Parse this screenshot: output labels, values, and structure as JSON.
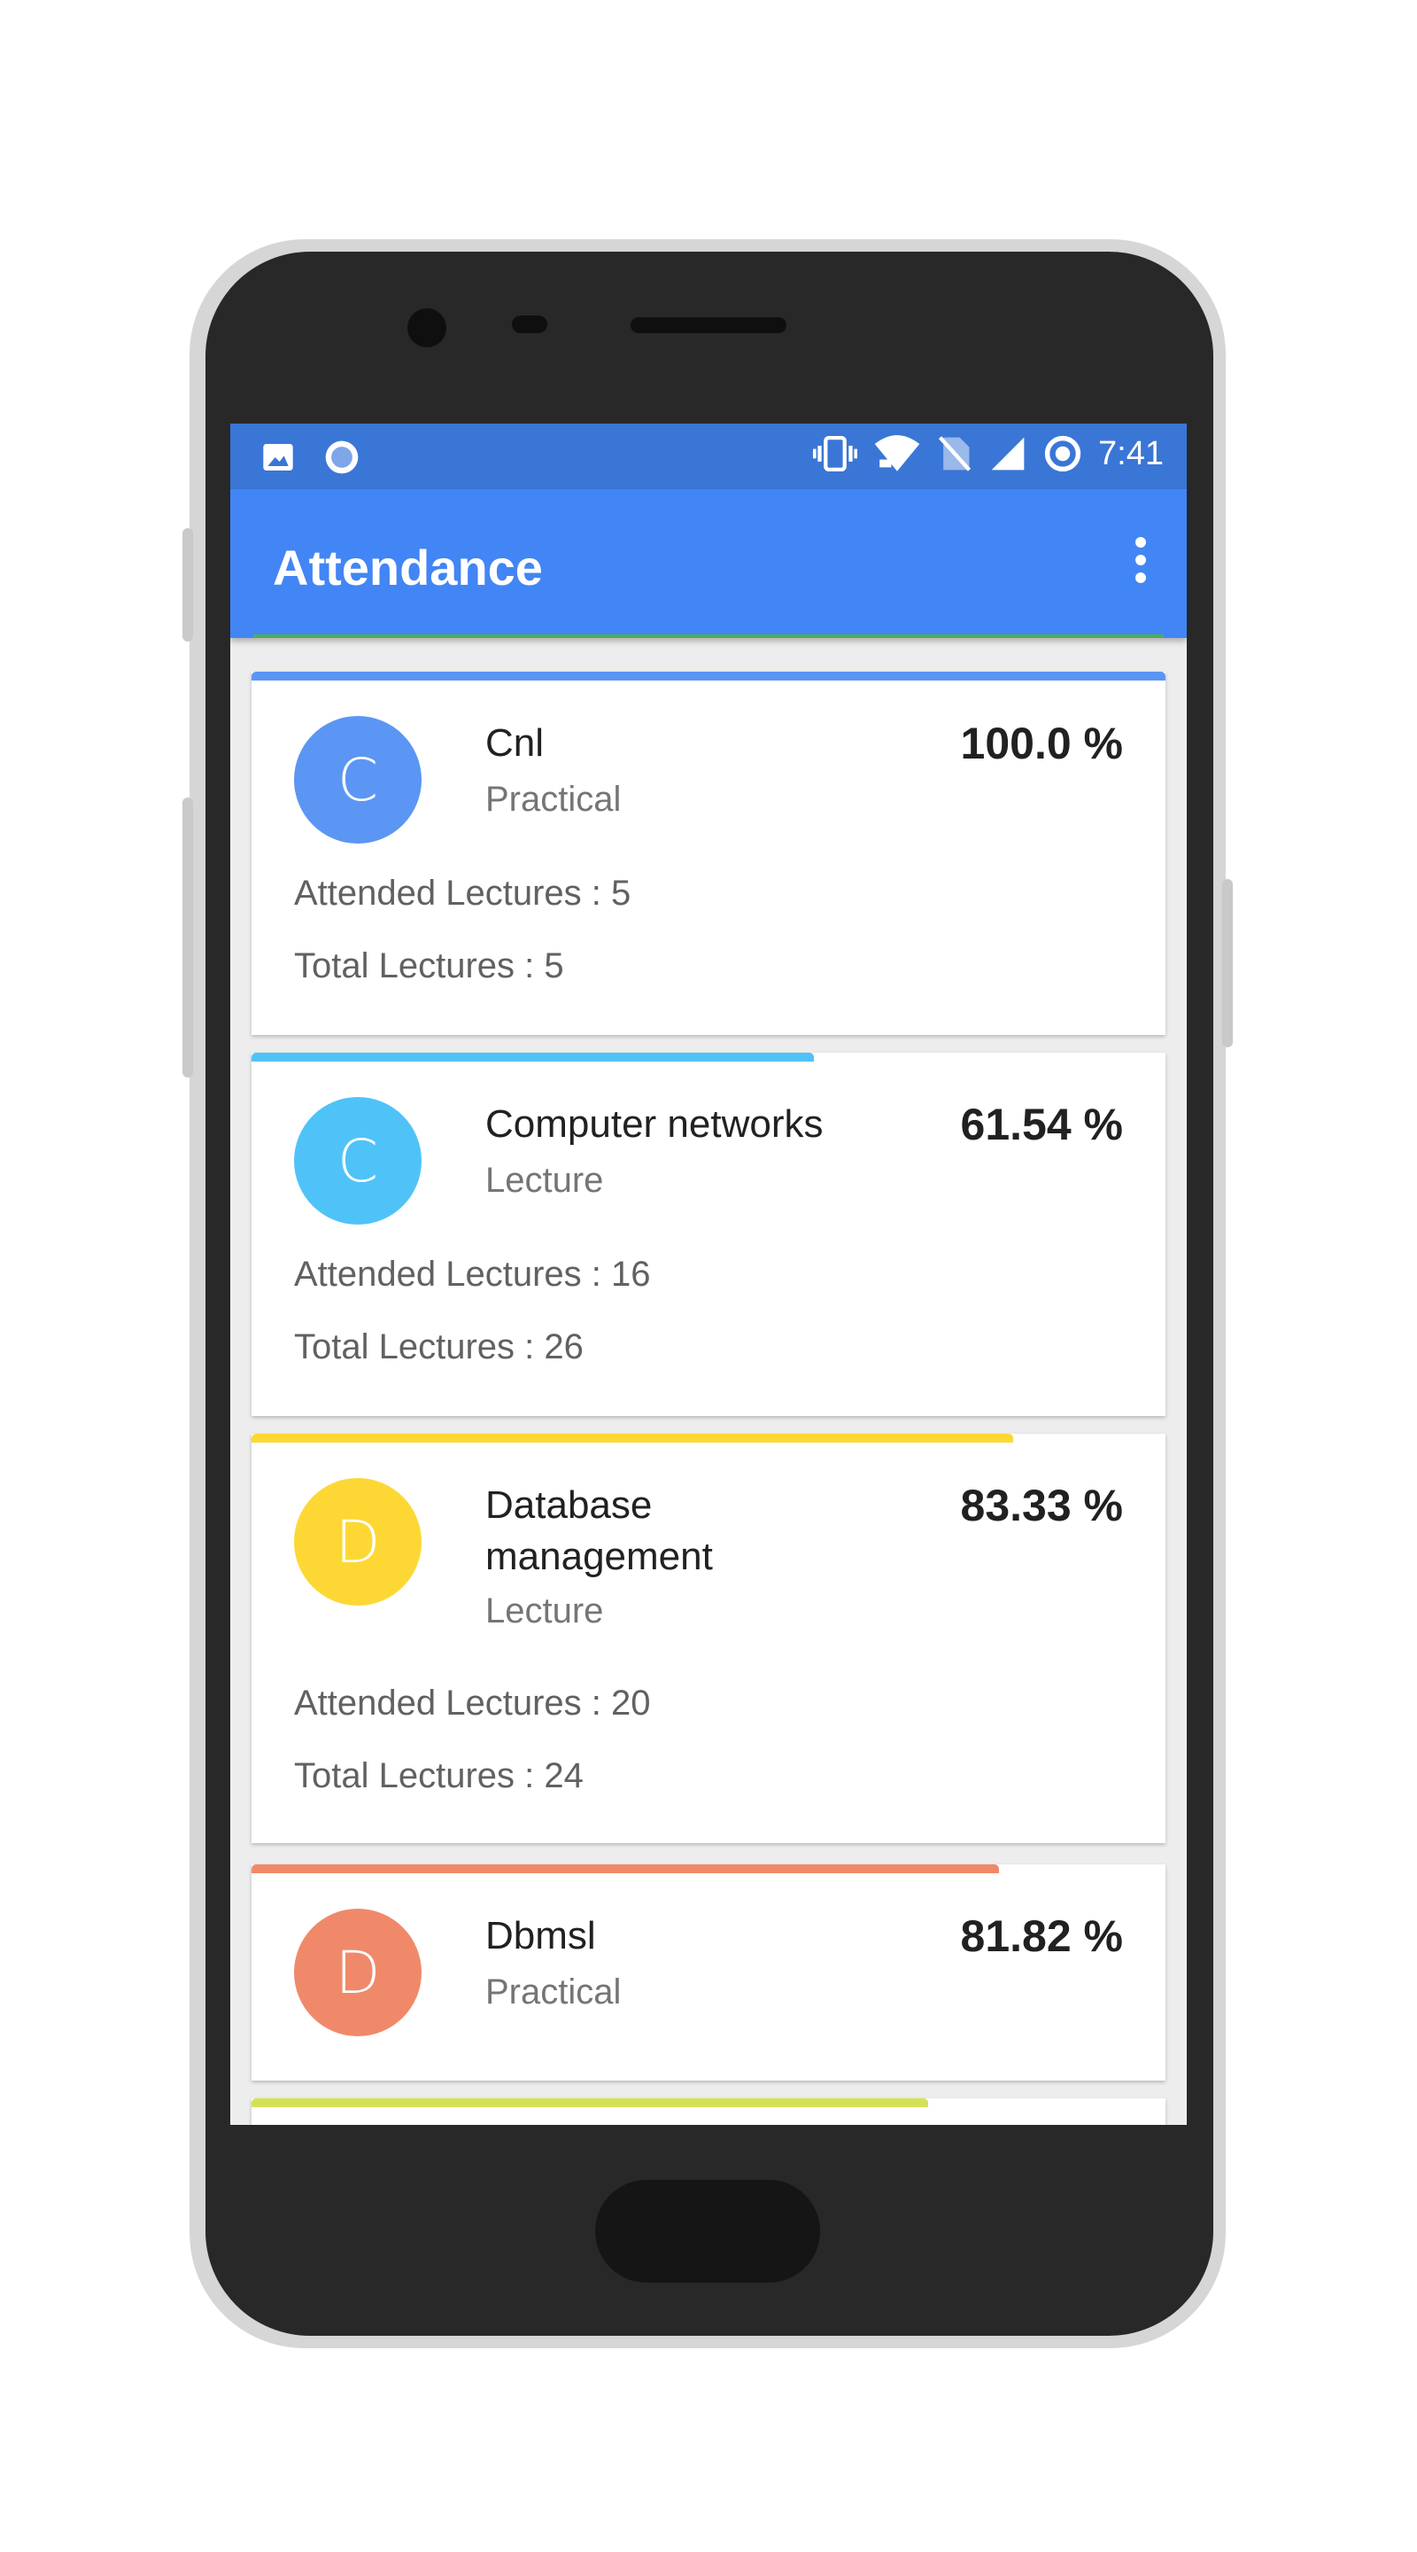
{
  "status_bar": {
    "time": "7:41",
    "left_icons": [
      "image-icon",
      "record-icon"
    ],
    "right_icons": [
      "vibrate-icon",
      "wifi-icon",
      "no-sim-icon",
      "signal-icon",
      "location-icon"
    ]
  },
  "app_bar": {
    "title": "Attendance",
    "menu_icon": "more-vert-icon"
  },
  "colors": {
    "status_bar": "#3a76d6",
    "app_bar": "#4285f4"
  },
  "subjects": [
    {
      "initial": "C",
      "name": "Cnl",
      "type": "Practical",
      "percent": "100.0 %",
      "percent_value": 100.0,
      "attended": "Attended Lectures : 5",
      "total": "Total Lectures : 5",
      "color": "#5b96f4"
    },
    {
      "initial": "C",
      "name": "Computer networks",
      "type": "Lecture",
      "percent": "61.54 %",
      "percent_value": 61.54,
      "attended": "Attended Lectures : 16",
      "total": "Total Lectures : 26",
      "color": "#4fc3f7"
    },
    {
      "initial": "D",
      "name": "Database management",
      "type": "Lecture",
      "percent": "83.33 %",
      "percent_value": 83.33,
      "attended": "Attended Lectures : 20",
      "total": "Total Lectures : 24",
      "color": "#fdd835"
    },
    {
      "initial": "D",
      "name": "Dbmsl",
      "type": "Practical",
      "percent": "81.82 %",
      "percent_value": 81.82,
      "color": "#f0896a"
    },
    {
      "percent_value": 74.0,
      "color": "#d4e157"
    }
  ]
}
